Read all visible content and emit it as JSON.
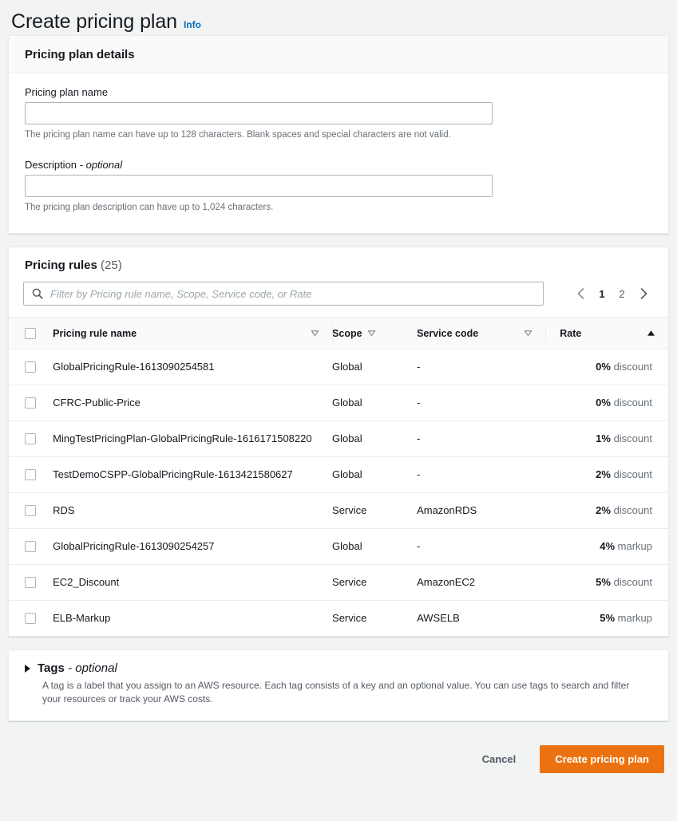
{
  "header": {
    "title": "Create pricing plan",
    "info_label": "Info"
  },
  "details_card": {
    "heading": "Pricing plan details",
    "name_field": {
      "label": "Pricing plan name",
      "value": "",
      "placeholder": "",
      "hint": "The pricing plan name can have up to 128 characters. Blank spaces and special characters are not valid."
    },
    "description_field": {
      "label": "Description",
      "optional_suffix": "- optional",
      "value": "",
      "placeholder": "",
      "hint": "The pricing plan description can have up to 1,024 characters."
    }
  },
  "rules_card": {
    "title": "Pricing rules",
    "count": "(25)",
    "search": {
      "placeholder": "Filter by Pricing rule name, Scope, Service code, or Rate",
      "value": "",
      "icon": "search-icon"
    },
    "pagination": {
      "prev_icon": "chevron-left-icon",
      "next_icon": "chevron-right-icon",
      "pages": [
        "1",
        "2"
      ],
      "active_page": "1"
    },
    "columns": [
      {
        "label": "Pricing rule name",
        "sort_icon": "sort-descending-icon",
        "sort_active": false
      },
      {
        "label": "Scope",
        "sort_icon": "sort-descending-icon",
        "sort_active": false
      },
      {
        "label": "Service code",
        "sort_icon": "sort-descending-icon",
        "sort_active": false
      },
      {
        "label": "Rate",
        "sort_icon": "sort-ascending-icon",
        "sort_active": true
      }
    ],
    "rows": [
      {
        "name": "GlobalPricingRule-1613090254581",
        "scope": "Global",
        "service_code": "-",
        "rate_value": "0%",
        "rate_kind": "discount",
        "selected": false
      },
      {
        "name": "CFRC-Public-Price",
        "scope": "Global",
        "service_code": "-",
        "rate_value": "0%",
        "rate_kind": "discount",
        "selected": false
      },
      {
        "name": "MingTestPricingPlan-GlobalPricingRule-1616171508220",
        "scope": "Global",
        "service_code": "-",
        "rate_value": "1%",
        "rate_kind": "discount",
        "selected": false
      },
      {
        "name": "TestDemoCSPP-GlobalPricingRule-1613421580627",
        "scope": "Global",
        "service_code": "-",
        "rate_value": "2%",
        "rate_kind": "discount",
        "selected": false
      },
      {
        "name": "RDS",
        "scope": "Service",
        "service_code": "AmazonRDS",
        "rate_value": "2%",
        "rate_kind": "discount",
        "selected": false
      },
      {
        "name": "GlobalPricingRule-1613090254257",
        "scope": "Global",
        "service_code": "-",
        "rate_value": "4%",
        "rate_kind": "markup",
        "selected": false
      },
      {
        "name": "EC2_Discount",
        "scope": "Service",
        "service_code": "AmazonEC2",
        "rate_value": "5%",
        "rate_kind": "discount",
        "selected": false
      },
      {
        "name": "ELB-Markup",
        "scope": "Service",
        "service_code": "AWSELB",
        "rate_value": "5%",
        "rate_kind": "markup",
        "selected": false
      }
    ]
  },
  "tags_card": {
    "title": "Tags",
    "optional_suffix": "- optional",
    "expanded": false,
    "toggle_icon": "triangle-right-icon",
    "description": "A tag is a label that you assign to an AWS resource. Each tag consists of a key and an optional value. You can use tags to search and filter your resources or track your AWS costs."
  },
  "footer": {
    "cancel_label": "Cancel",
    "submit_label": "Create pricing plan"
  },
  "colors": {
    "accent_orange": "#ec7211",
    "link_blue": "#0073bb",
    "text_primary": "#16191f",
    "text_secondary": "#545b64",
    "border": "#eaeded",
    "page_bg": "#f2f3f3"
  }
}
